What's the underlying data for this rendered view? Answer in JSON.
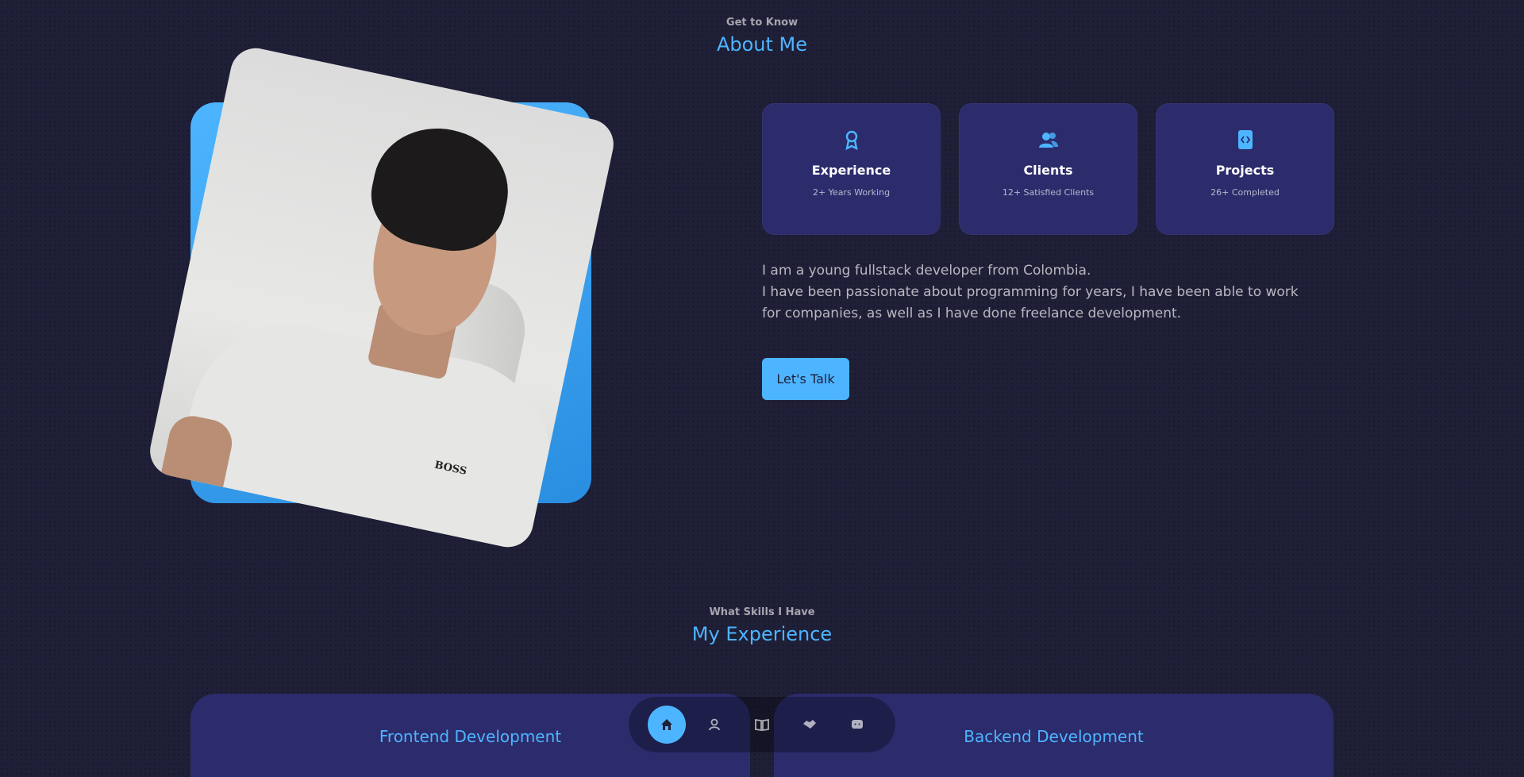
{
  "about": {
    "subtitle": "Get to Know",
    "title": "About Me",
    "cards": [
      {
        "icon": "award-icon",
        "title": "Experience",
        "detail": "2+ Years Working"
      },
      {
        "icon": "users-icon",
        "title": "Clients",
        "detail": "12+ Satisfied Clients"
      },
      {
        "icon": "folder-code-icon",
        "title": "Projects",
        "detail": "26+ Completed"
      }
    ],
    "paragraph_1": "I am a young fullstack developer from Colombia.",
    "paragraph_2": "I have been passionate about programming for years, I have been able to work for companies, as well as I have done freelance development.",
    "cta_label": "Let's Talk",
    "photo_logo": "BOSS"
  },
  "experience": {
    "subtitle": "What Skills I Have",
    "title": "My Experience",
    "frontend_title": "Frontend Development",
    "backend_title": "Backend Development"
  },
  "nav": {
    "items": [
      "home-icon",
      "user-icon",
      "book-icon",
      "handshake-icon",
      "chat-icon"
    ],
    "active": "home-icon"
  },
  "colors": {
    "background": "#1f1f38",
    "primary": "#4db5ff",
    "card": "#2c2c6c"
  }
}
